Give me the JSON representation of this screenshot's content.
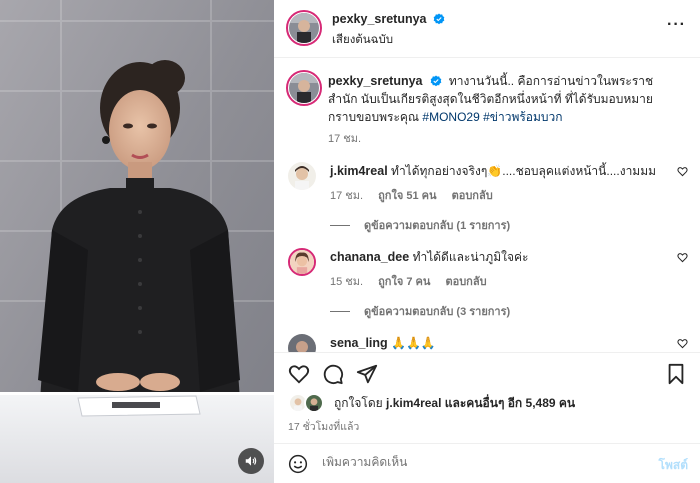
{
  "post_header": {
    "username": "pexky_sretunya",
    "subtitle": "เสียงต้นฉบับ"
  },
  "caption": {
    "username": "pexky_sretunya",
    "text": "ทางานวันนี้.. คือการอ่านข่าวในพระราชสำนัก นับเป็นเกียรติสูงสุดในชีวิตอีกหนึ่งหน้าที่ ที่ได้รับมอบหมาย กราบขอบพระคุณ",
    "hashtags": "#MONO29 #ข่าวพร้อมบวก",
    "time": "17 ชม."
  },
  "comments": [
    {
      "username": "j.kim4real",
      "text": "ทำได้ทุกอย่างจริงๆ👏....ชอบลุคแต่งหน้านี้....งามมม",
      "time": "17 ชม.",
      "likes": "ถูกใจ 51 คน",
      "reply": "ตอบกลับ",
      "view_replies": "ดูข้อความตอบกลับ (1 รายการ)"
    },
    {
      "username": "chanana_dee",
      "text": "ทำได้ดีและน่าภูมิใจค่ะ",
      "time": "15 ชม.",
      "likes": "ถูกใจ 7 คน",
      "reply": "ตอบกลับ",
      "view_replies": "ดูข้อความตอบกลับ (3 รายการ)"
    },
    {
      "username": "sena_ling",
      "text": "🙏🙏🙏"
    }
  ],
  "likes": {
    "prefix": "ถูกใจโดย",
    "user": "j.kim4real",
    "suffix": "และคนอื่นๆ อีก 5,489 คน"
  },
  "time_ago": "17 ชั่วโมงที่แล้ว",
  "comment_box": {
    "placeholder": "เพิ่มความคิดเห็น",
    "post_label": "โพสต์"
  },
  "colors": {
    "verified": "#0095f6",
    "hashtag": "#00376b",
    "muted": "#737373",
    "post_disabled": "#b2dffc"
  },
  "icons": [
    "sound-icon",
    "more-icon",
    "verified-icon",
    "heart-icon",
    "comment-icon",
    "share-icon",
    "bookmark-icon",
    "emoji-icon"
  ]
}
